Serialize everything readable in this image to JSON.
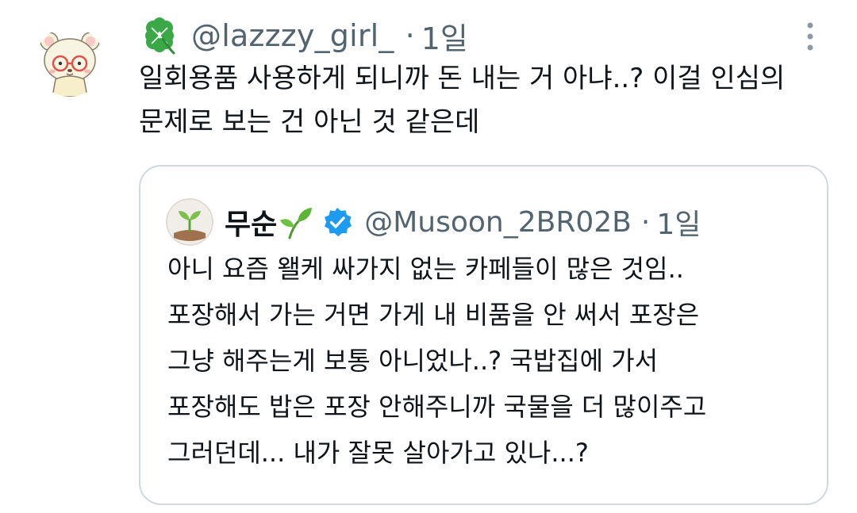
{
  "tweet": {
    "handle": "@lazzzy_girl_",
    "separator": "·",
    "time": "1일",
    "text_lines": [
      "일회용품 사용하게 되니까 돈 내는 거 아냐..? 이걸 인심의",
      "문제로 보는 건 아닌 것 같은데"
    ],
    "avatar_icon": "bear-with-glasses-avatar",
    "prefix_icon": "four-leaf-clover-icon",
    "more_icon": "vertical-ellipsis-icon"
  },
  "quote": {
    "display_name": "무순",
    "name_icon": "sprout-icon",
    "verified_icon": "verified-badge-icon",
    "handle": "@Musoon_2BR02B",
    "separator": "·",
    "time": "1일",
    "avatar_icon": "sprout-avatar",
    "text_lines": [
      "아니 요즘 왤케 싸가지 없는 카페들이 많은 것임..",
      "포장해서 가는 거면 가게 내 비품을 안 써서 포장은",
      "그냥 해주는게 보통 아니었나..? 국밥집에 가서",
      "포장해도 밥은 포장 안해주니까 국물을 더 많이주고",
      "그러던데... 내가 잘못 살아가고 있나...?"
    ]
  },
  "colors": {
    "text": "#0f1419",
    "secondary": "#536471",
    "border": "#cfd9de",
    "verified": "#1d9bf0",
    "clover": "#3aa847"
  }
}
